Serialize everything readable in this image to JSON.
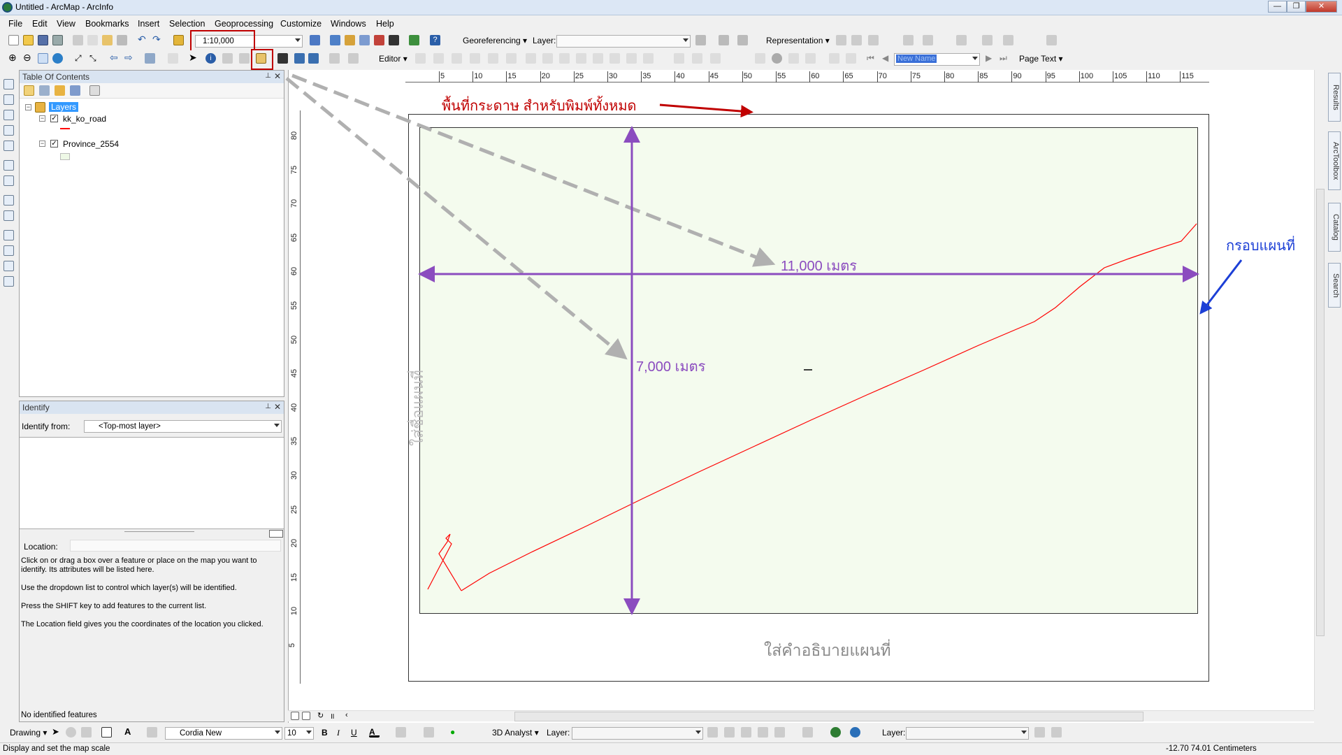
{
  "window": {
    "title": "Untitled - ArcMap - ArcInfo"
  },
  "menu": [
    "File",
    "Edit",
    "View",
    "Bookmarks",
    "Insert",
    "Selection",
    "Geoprocessing",
    "Customize",
    "Windows",
    "Help"
  ],
  "standard_toolbar": {
    "scale_value": "1:10,000"
  },
  "georef_toolbar": {
    "georeferencing_label": "Georeferencing",
    "layer_label": "Layer:",
    "representation_label": "Representation"
  },
  "tools_toolbar": {
    "editor_label": "Editor",
    "page_text_label": "Page Text",
    "new_name": "New Name"
  },
  "toc": {
    "title": "Table Of Contents",
    "root": "Layers",
    "layers": [
      {
        "name": "kk_ko_road",
        "checked": true,
        "swatch": "#ff0000"
      },
      {
        "name": "Province_2554",
        "checked": true,
        "swatch": "#eef8e6"
      }
    ]
  },
  "identify": {
    "title": "Identify",
    "from_label": "Identify from:",
    "from_value": "<Top-most layer>",
    "location_label": "Location:",
    "help_lines": [
      "Click on or drag a box over a feature or place on the map you want to identify. Its attributes will be listed here.",
      "Use the dropdown list to control which layer(s) will be identified.",
      "Press the SHIFT key to add features to the current list.",
      "The Location field gives you the coordinates of the location you clicked."
    ],
    "status": "No identified features"
  },
  "ruler": {
    "h_ticks": [
      "5",
      "10",
      "15",
      "20",
      "25",
      "30",
      "35",
      "40",
      "45",
      "50",
      "55",
      "60",
      "65",
      "70",
      "75",
      "80",
      "85",
      "90",
      "95",
      "100",
      "105",
      "110",
      "115"
    ],
    "v_ticks": [
      "80",
      "75",
      "70",
      "65",
      "60",
      "55",
      "50",
      "45",
      "40",
      "35",
      "30",
      "25",
      "20",
      "15",
      "10",
      "5"
    ]
  },
  "layout": {
    "map_title": "ใส่ชื่อแผนที่",
    "caption": "ใส่คำอธิบายแผนที่",
    "annotation_paper": "พื้นที่กระดาษ สำหรับพิมพ์ทั้งหมด",
    "annotation_frame": "กรอบแผนที่",
    "width_label": "11,000 เมตร",
    "height_label": "7,000 เมตร",
    "colors": {
      "annotation_red": "#c00000",
      "dimension_purple": "#8b4cbf",
      "frame_blue": "#1c3fd6",
      "road": "#ff0000",
      "frame_fill": "#f4fbee"
    }
  },
  "right_dock": [
    "Results",
    "ArcToolbox",
    "Catalog",
    "Search"
  ],
  "drawing_toolbar": {
    "drawing_label": "Drawing",
    "font": "Cordia New",
    "size": "10",
    "bold": "B",
    "italic": "I",
    "underline": "U",
    "analyst_label": "3D Analyst",
    "layer_label": "Layer:",
    "layer_label_2": "Layer:"
  },
  "status": {
    "message": "Display and set the map scale",
    "coords": "-12.70  74.01 Centimeters"
  }
}
